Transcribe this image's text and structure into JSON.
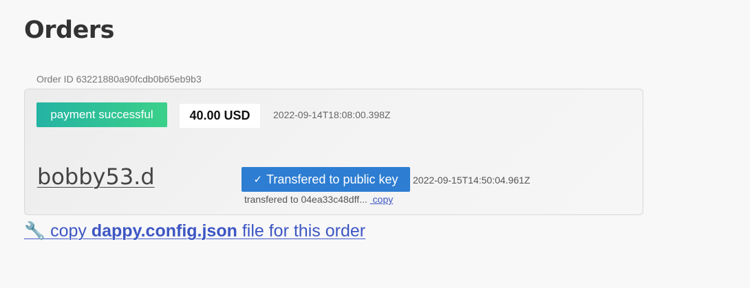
{
  "page": {
    "title": "Orders"
  },
  "order": {
    "id_label": "Order ID 63221880a90fcdb0b65eb9b3",
    "status": "payment successful",
    "status_color": "#2fc198",
    "amount": "40.00 USD",
    "created_at": "2022-09-14T18:08:00.398Z",
    "name": "bobby53.d",
    "transfer_button": {
      "icon": "check-icon",
      "icon_glyph": "✓",
      "label": "Transfered to public key",
      "color": "#2d7dd2"
    },
    "transferred_at": "2022-09-15T14:50:04.961Z",
    "transfer_info": "transfered to 04ea33c48dff...",
    "copy_label": " copy"
  },
  "config_link": {
    "icon": "wrench-icon",
    "icon_glyph": "🔧",
    "prefix": " copy ",
    "filename": "dappy.config.json",
    "suffix": " file for this order",
    "color": "#3d56c4"
  }
}
